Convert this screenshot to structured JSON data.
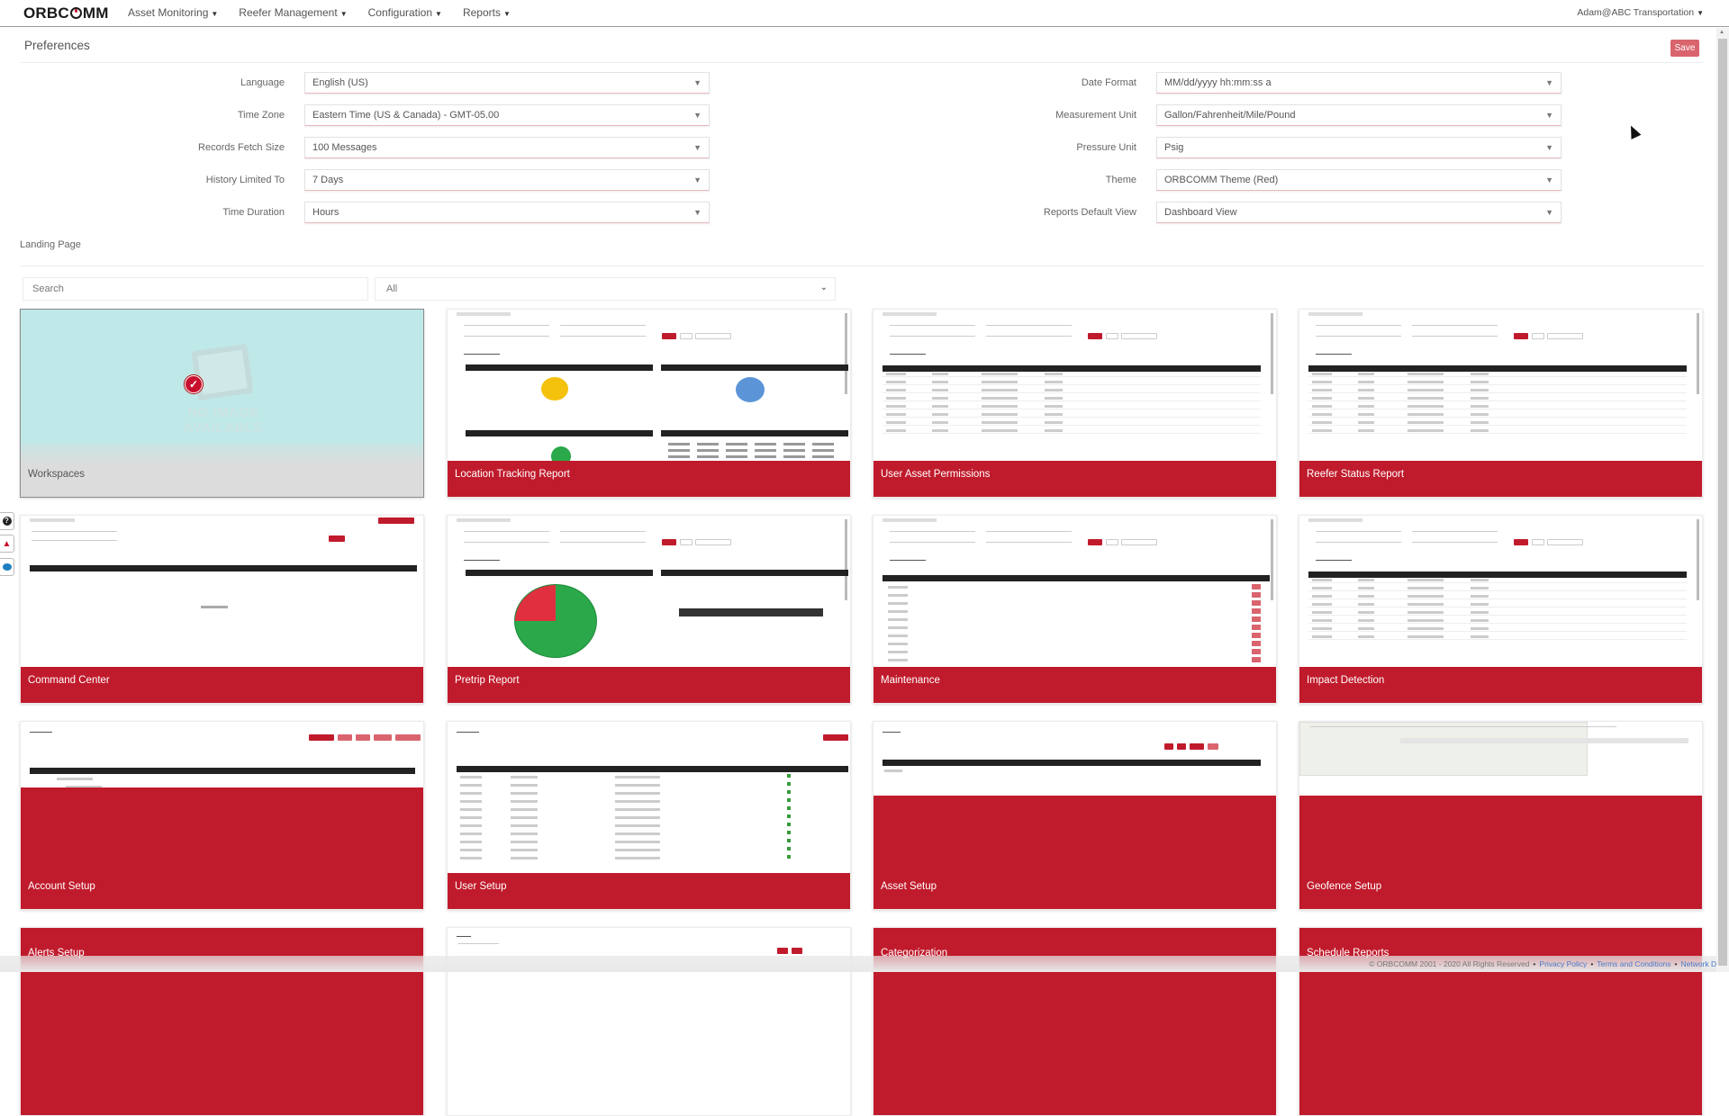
{
  "nav": {
    "logo": "ORBCOMM",
    "items": [
      {
        "label": "Asset Monitoring"
      },
      {
        "label": "Reefer Management"
      },
      {
        "label": "Configuration"
      },
      {
        "label": "Reports"
      }
    ],
    "user": "Adam@ABC Transportation"
  },
  "page": {
    "title": "Preferences",
    "save_label": "Save"
  },
  "preferences": {
    "left": [
      {
        "label": "Language",
        "value": "English (US)"
      },
      {
        "label": "Time Zone",
        "value": "Eastern Time (US & Canada) - GMT-05.00"
      },
      {
        "label": "Records Fetch Size",
        "value": "100 Messages"
      },
      {
        "label": "History Limited To",
        "value": "7 Days"
      },
      {
        "label": "Time Duration",
        "value": "Hours"
      }
    ],
    "right": [
      {
        "label": "Date Format",
        "value": "MM/dd/yyyy hh:mm:ss a"
      },
      {
        "label": "Measurement Unit",
        "value": "Gallon/Fahrenheit/Mile/Pound"
      },
      {
        "label": "Pressure Unit",
        "value": "Psig"
      },
      {
        "label": "Theme",
        "value": "ORBCOMM Theme (Red)"
      },
      {
        "label": "Reports Default View",
        "value": "Dashboard View"
      }
    ]
  },
  "landing": {
    "section_label": "Landing Page",
    "search_placeholder": "Search",
    "filter_value": "All",
    "no_image_text": "NO IMAGE AVAILABLE",
    "selected_card": "Workspaces",
    "cards": [
      {
        "label": "Workspaces",
        "selected": true
      },
      {
        "label": "Location Tracking Report"
      },
      {
        "label": "User Asset Permissions"
      },
      {
        "label": "Reefer Status Report"
      },
      {
        "label": "Command Center"
      },
      {
        "label": "Pretrip Report"
      },
      {
        "label": "Maintenance"
      },
      {
        "label": "Impact Detection"
      },
      {
        "label": "Account Setup"
      },
      {
        "label": "User Setup"
      },
      {
        "label": "Asset Setup"
      },
      {
        "label": "Geofence Setup"
      },
      {
        "label": "Alerts Setup"
      },
      {
        "label": ""
      },
      {
        "label": "Categorization"
      },
      {
        "label": "Schedule Reports"
      }
    ]
  },
  "side_icons": [
    "help-icon",
    "bell-icon",
    "chat-icon"
  ],
  "footer": {
    "copyright": "© ORBCOMM 2001 - 2020 All Rights Reserved",
    "links": [
      "Privacy Policy",
      "Terms and Conditions",
      "Network Data"
    ]
  },
  "colors": {
    "brand_red": "#c01b2c",
    "save_button": "#d9646e",
    "selected_card": "#bfe8e8",
    "link": "#4a7bc8"
  }
}
